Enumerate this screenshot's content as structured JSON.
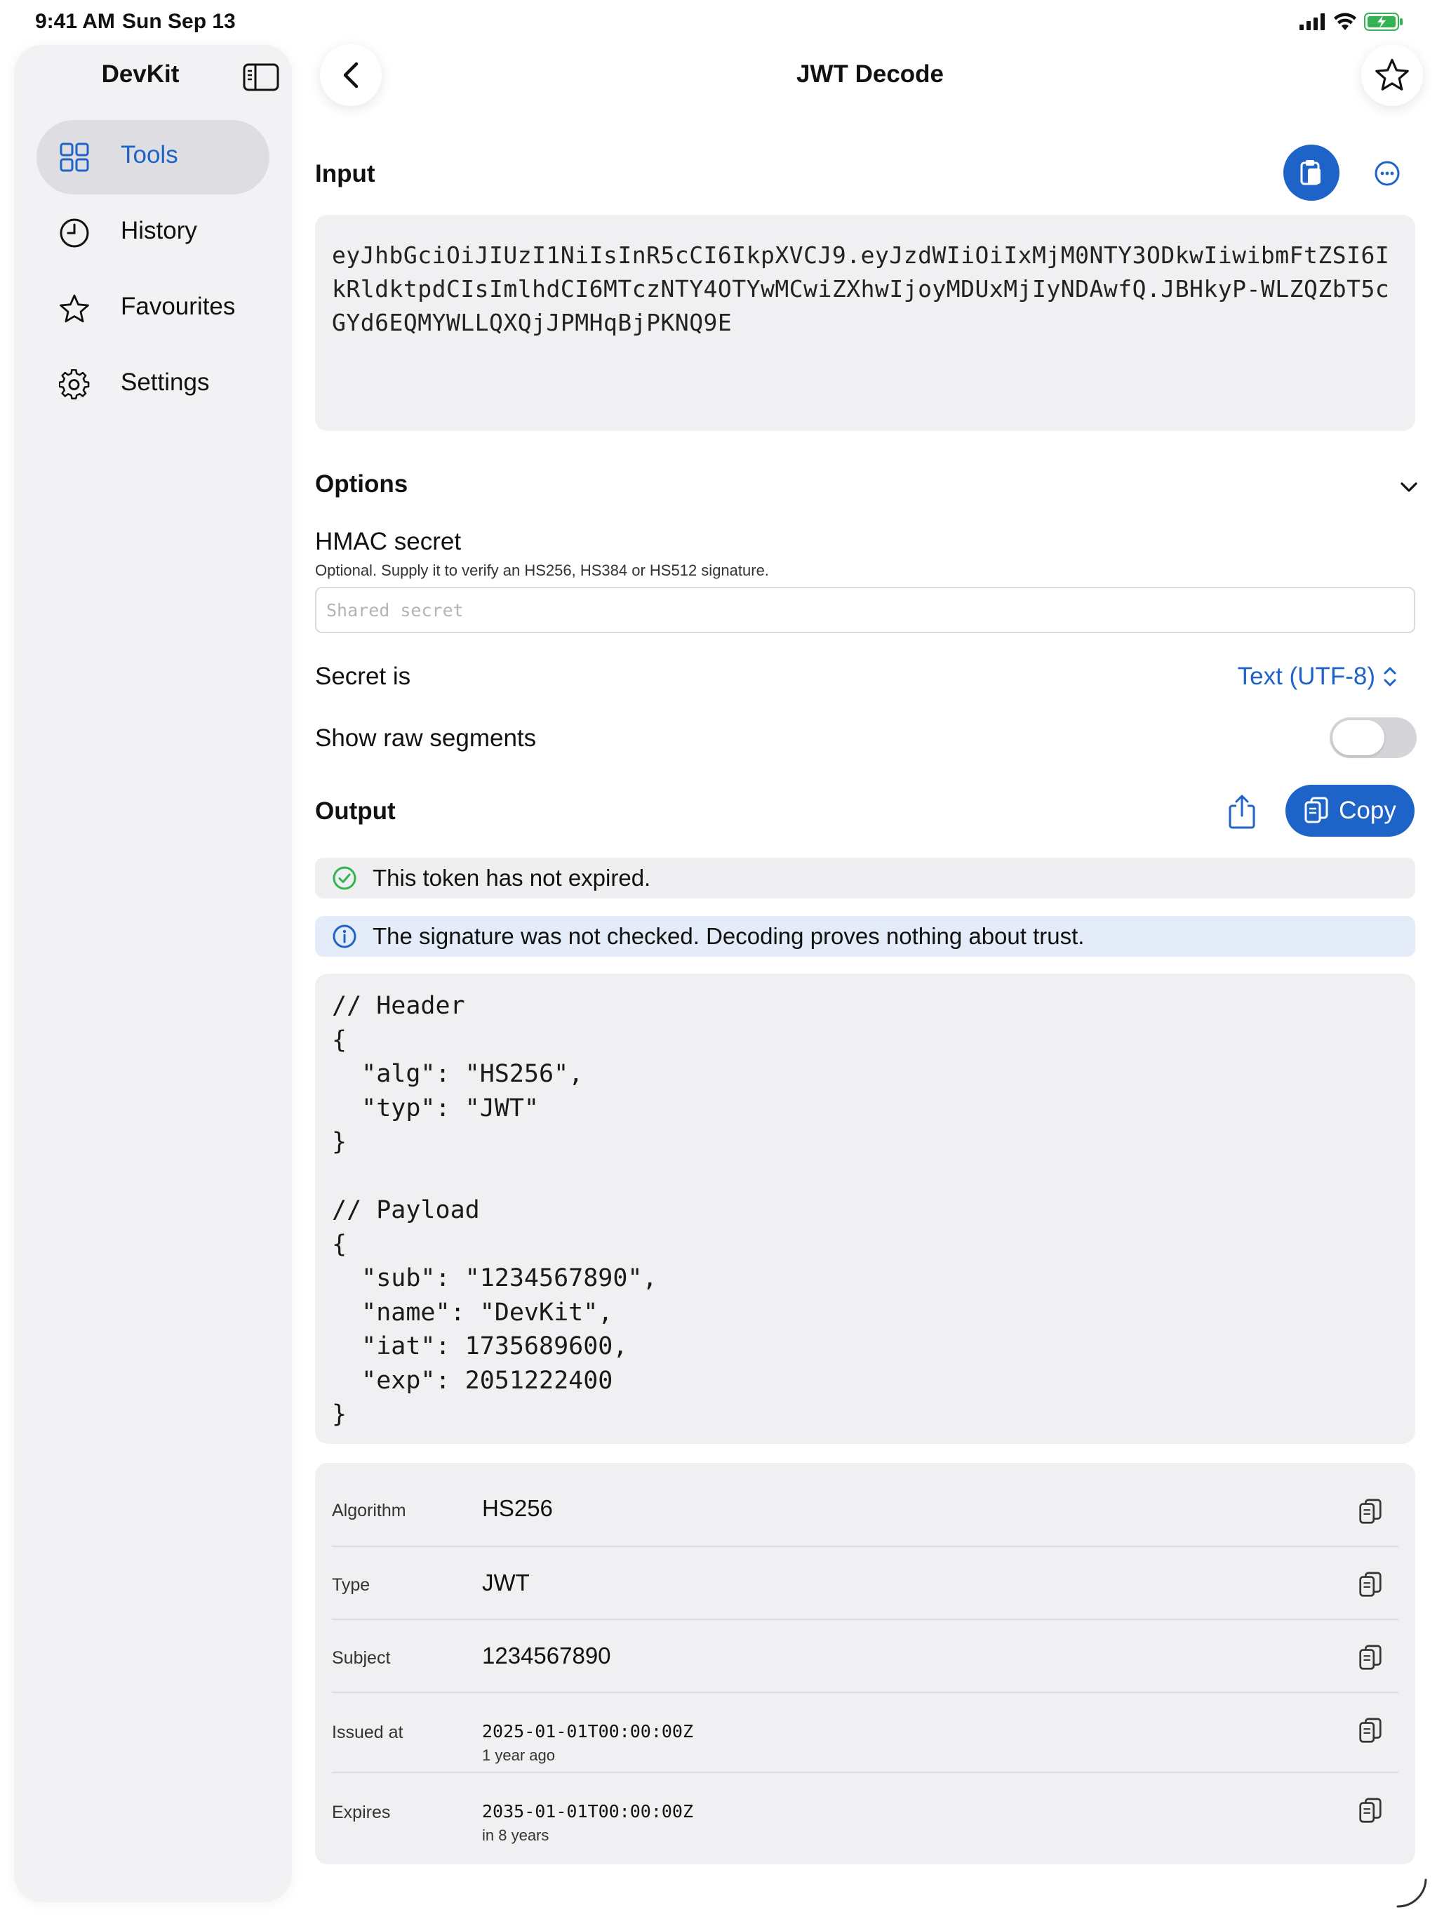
{
  "status_bar": {
    "time": "9:41 AM",
    "date": "Sun Sep 13"
  },
  "sidebar": {
    "title": "DevKit",
    "items": [
      {
        "label": "Tools",
        "icon": "grid-icon",
        "active": true
      },
      {
        "label": "History",
        "icon": "clock-icon",
        "active": false
      },
      {
        "label": "Favourites",
        "icon": "star-icon",
        "active": false
      },
      {
        "label": "Settings",
        "icon": "gear-icon",
        "active": false
      }
    ]
  },
  "header": {
    "title": "JWT Decode"
  },
  "input": {
    "title": "Input",
    "token": "eyJhbGciOiJIUzI1NiIsInR5cCI6IkpXVCJ9.eyJzdWIiOiIxMjM0NTY3ODkwIiwibmFtZSI6IkRldktpdCIsImlhdCI6MTczNTY4OTYwMCwiZXhwIjoyMDUxMjIyNDAwfQ.JBHkyP-WLZQZbT5cGYd6EQMYWLLQXQjJPMHqBjPKNQ9E"
  },
  "options": {
    "title": "Options",
    "hmac_label": "HMAC secret",
    "hmac_help": "Optional. Supply it to verify an HS256, HS384 or HS512 signature.",
    "secret_placeholder": "Shared secret",
    "secret_is_label": "Secret is",
    "secret_is_value": "Text (UTF-8)",
    "raw_segments_label": "Show raw segments",
    "raw_segments_on": false
  },
  "output": {
    "title": "Output",
    "copy_label": "Copy",
    "expiry_banner": "This token has not expired.",
    "signature_banner": "The signature was not checked. Decoding proves nothing about trust.",
    "decoded_text": "// Header\n{\n  \"alg\": \"HS256\",\n  \"typ\": \"JWT\"\n}\n\n// Payload\n{\n  \"sub\": \"1234567890\",\n  \"name\": \"DevKit\",\n  \"iat\": 1735689600,\n  \"exp\": 2051222400\n}"
  },
  "details": [
    {
      "label": "Algorithm",
      "value": "HS256"
    },
    {
      "label": "Type",
      "value": "JWT"
    },
    {
      "label": "Subject",
      "value": "1234567890"
    },
    {
      "label": "Issued at",
      "value": "2025-01-01T00:00:00Z",
      "sub": "1 year ago"
    },
    {
      "label": "Expires",
      "value": "2035-01-01T00:00:00Z",
      "sub": "in 8 years"
    }
  ],
  "colors": {
    "accent": "#1e63c8",
    "success": "#34b352",
    "info_bg": "#e3ecf8"
  }
}
